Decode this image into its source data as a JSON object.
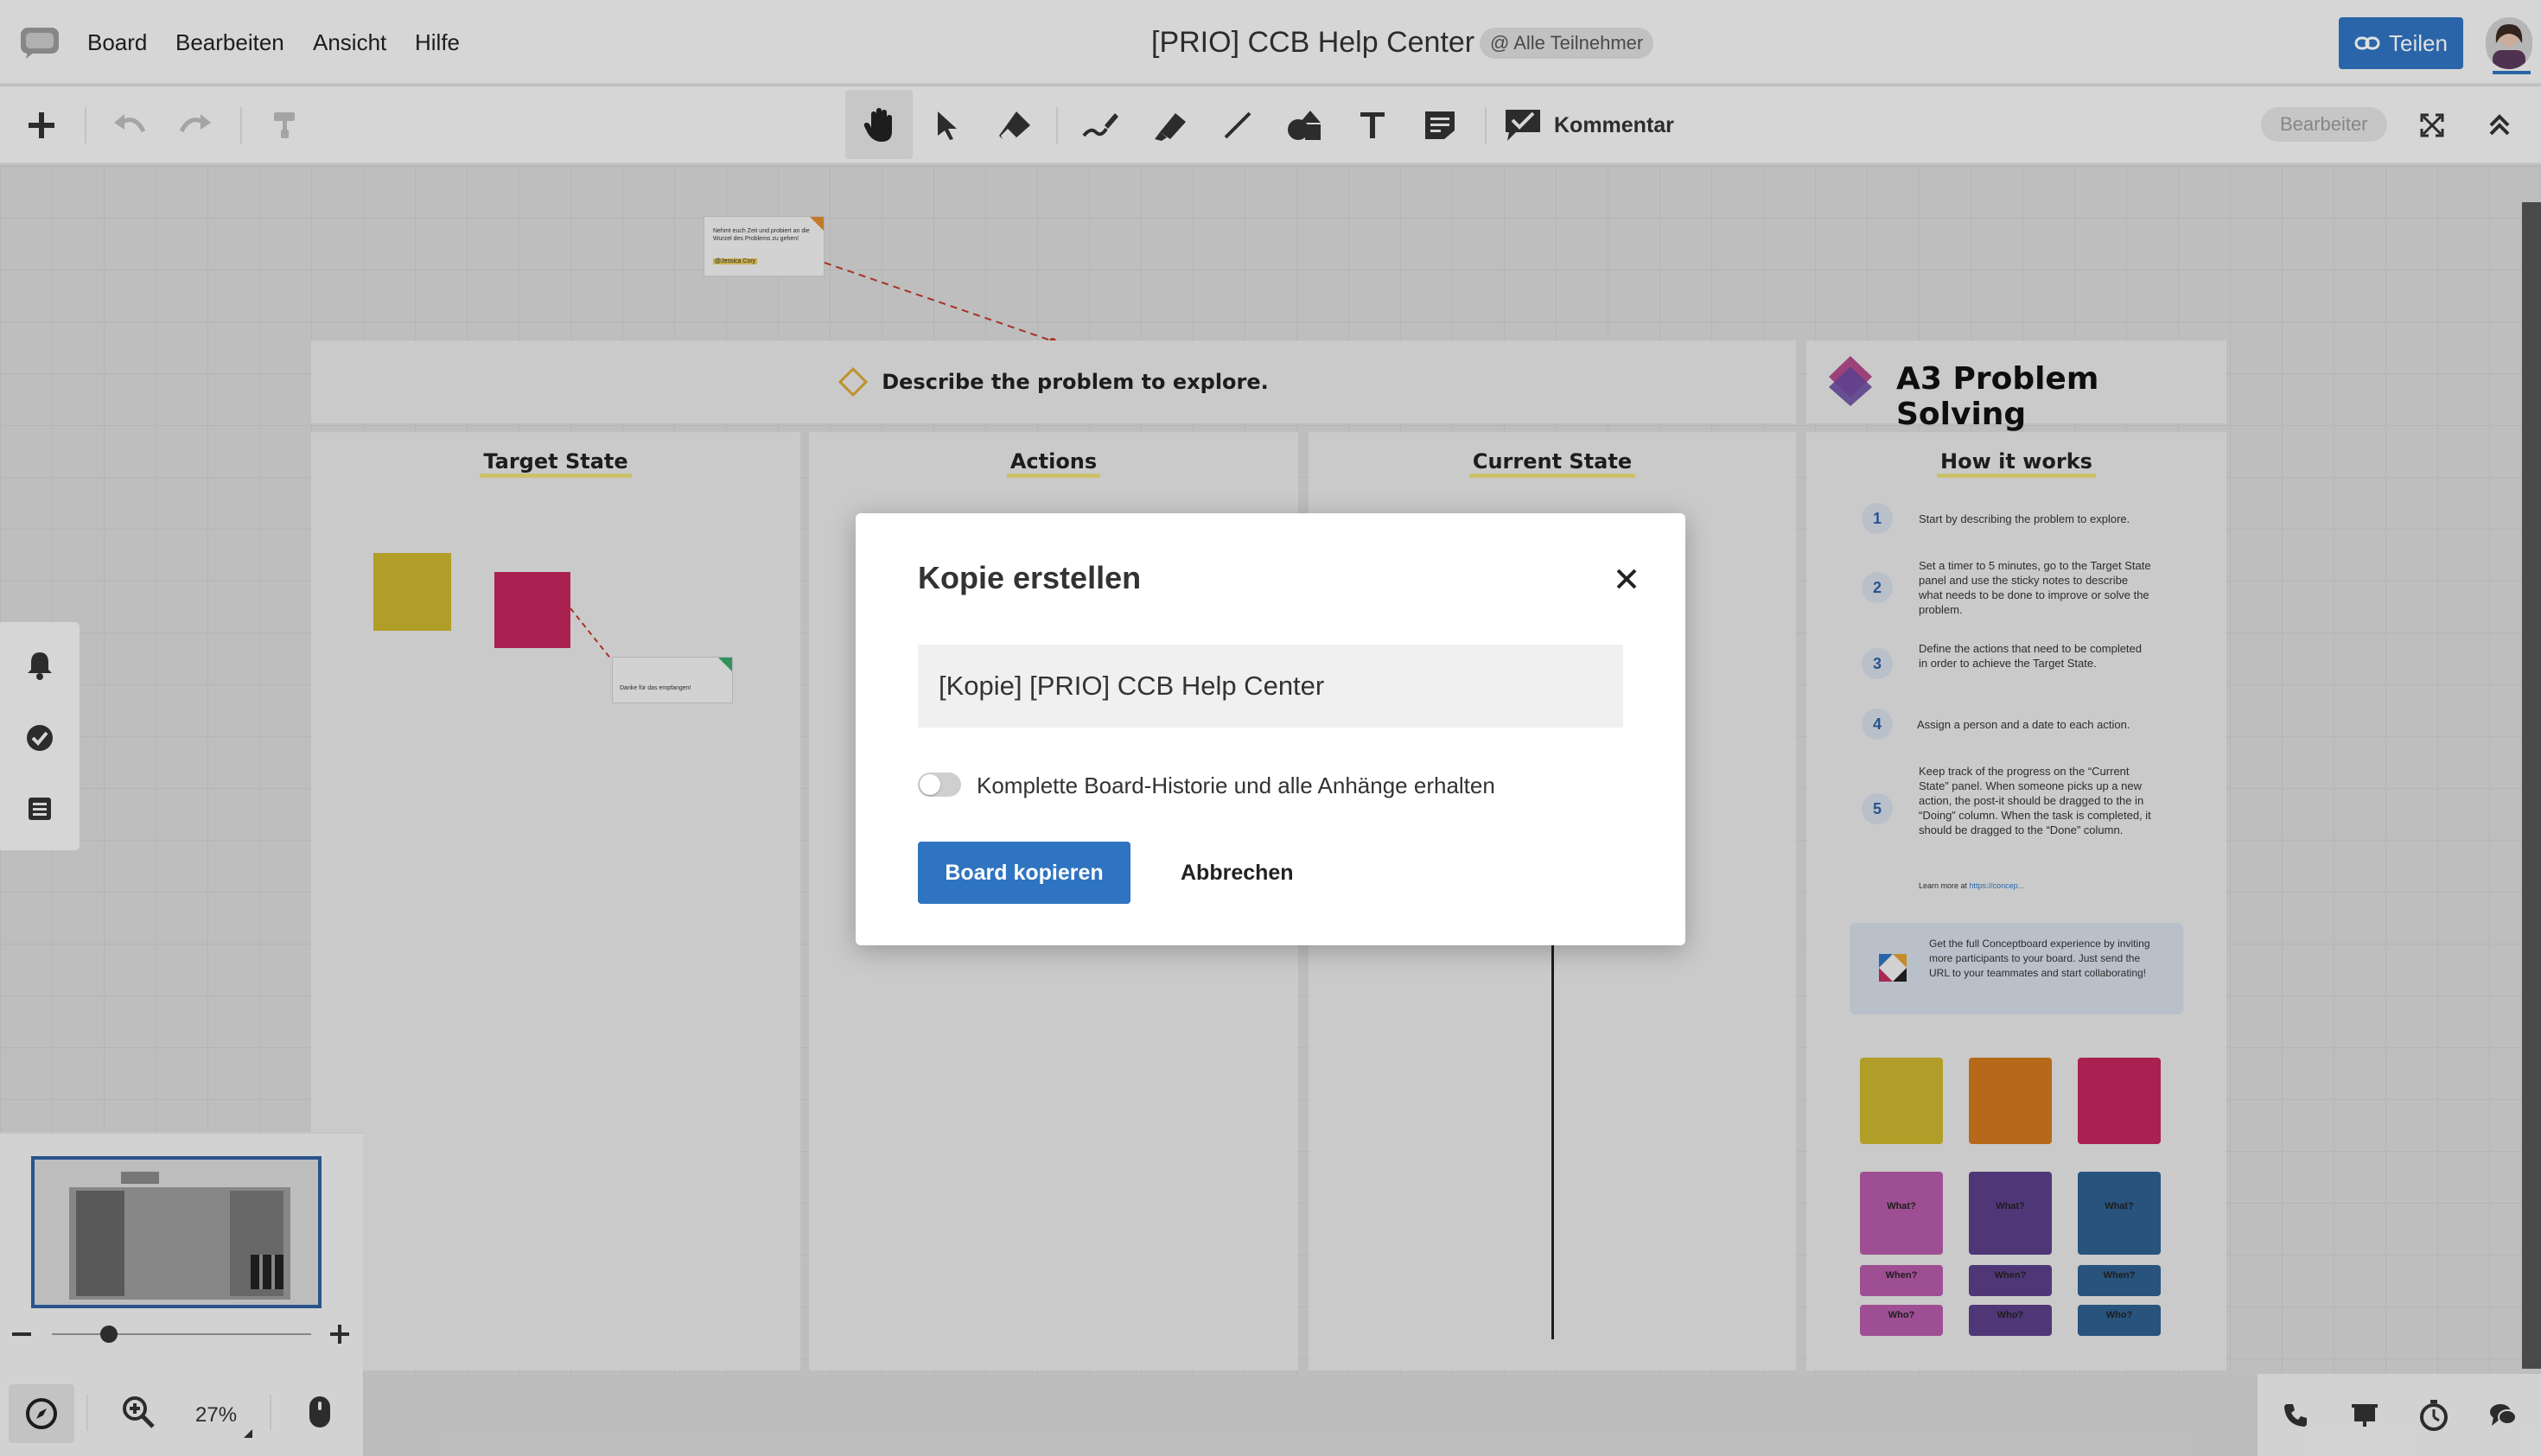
{
  "app": {
    "menu": [
      "Board",
      "Bearbeiten",
      "Ansicht",
      "Hilfe"
    ],
    "board_title": "[PRIO] CCB Help Center",
    "participants_badge": "@ Alle Teilnehmer",
    "share_label": "Teilen",
    "comment_label": "Kommentar",
    "mode_badge": "Bearbeiter",
    "accent": "#2f74c0"
  },
  "board": {
    "problem_prompt": "Describe the problem to explore.",
    "template_title": "A3 Problem Solving",
    "columns": [
      "Target State",
      "Actions",
      "Current State"
    ],
    "how_it_works": {
      "title": "How it works",
      "steps": [
        {
          "num": "1",
          "text": "Start by describing the problem to explore."
        },
        {
          "num": "2",
          "text": "Set a timer to 5 minutes, go to the Target State panel and use the sticky notes to describe what needs to be done to improve or solve the problem."
        },
        {
          "num": "3",
          "text": "Define the actions that need to be completed in order to achieve the Target State."
        },
        {
          "num": "4",
          "text": "Assign a person and a date to each action."
        },
        {
          "num": "5",
          "text": "Keep track of the progress on the “Current State” panel. When someone picks up a new action, the post-it should be dragged to the in “Doing” column. When the task is completed, it should be dragged to the “Done” column."
        }
      ],
      "learn_more": "Learn more at",
      "learn_more_link": "https://concep..."
    },
    "promo_text": "Get the full Conceptboard experience by inviting more participants to your board. Just send the URL to your teammates and start collaborating!",
    "sticky_what": "What?",
    "sticky_when": "When?",
    "sticky_who": "Who?",
    "comment_snippet_1": "Nehmt euch Zeit und probiert an die Wurzel des Problems zu gehen!",
    "comment_mention": "@Jessica Cory",
    "comment_snippet_2": "Danke für das empfangen!"
  },
  "bottom": {
    "zoom": "27%"
  },
  "dialog": {
    "title": "Kopie erstellen",
    "input_value": "[Kopie] [PRIO] CCB Help Center",
    "toggle_label": "Komplette Board-Historie und alle Anhänge erhalten",
    "toggle_on": false,
    "confirm_label": "Board kopieren",
    "cancel_label": "Abbrechen"
  }
}
